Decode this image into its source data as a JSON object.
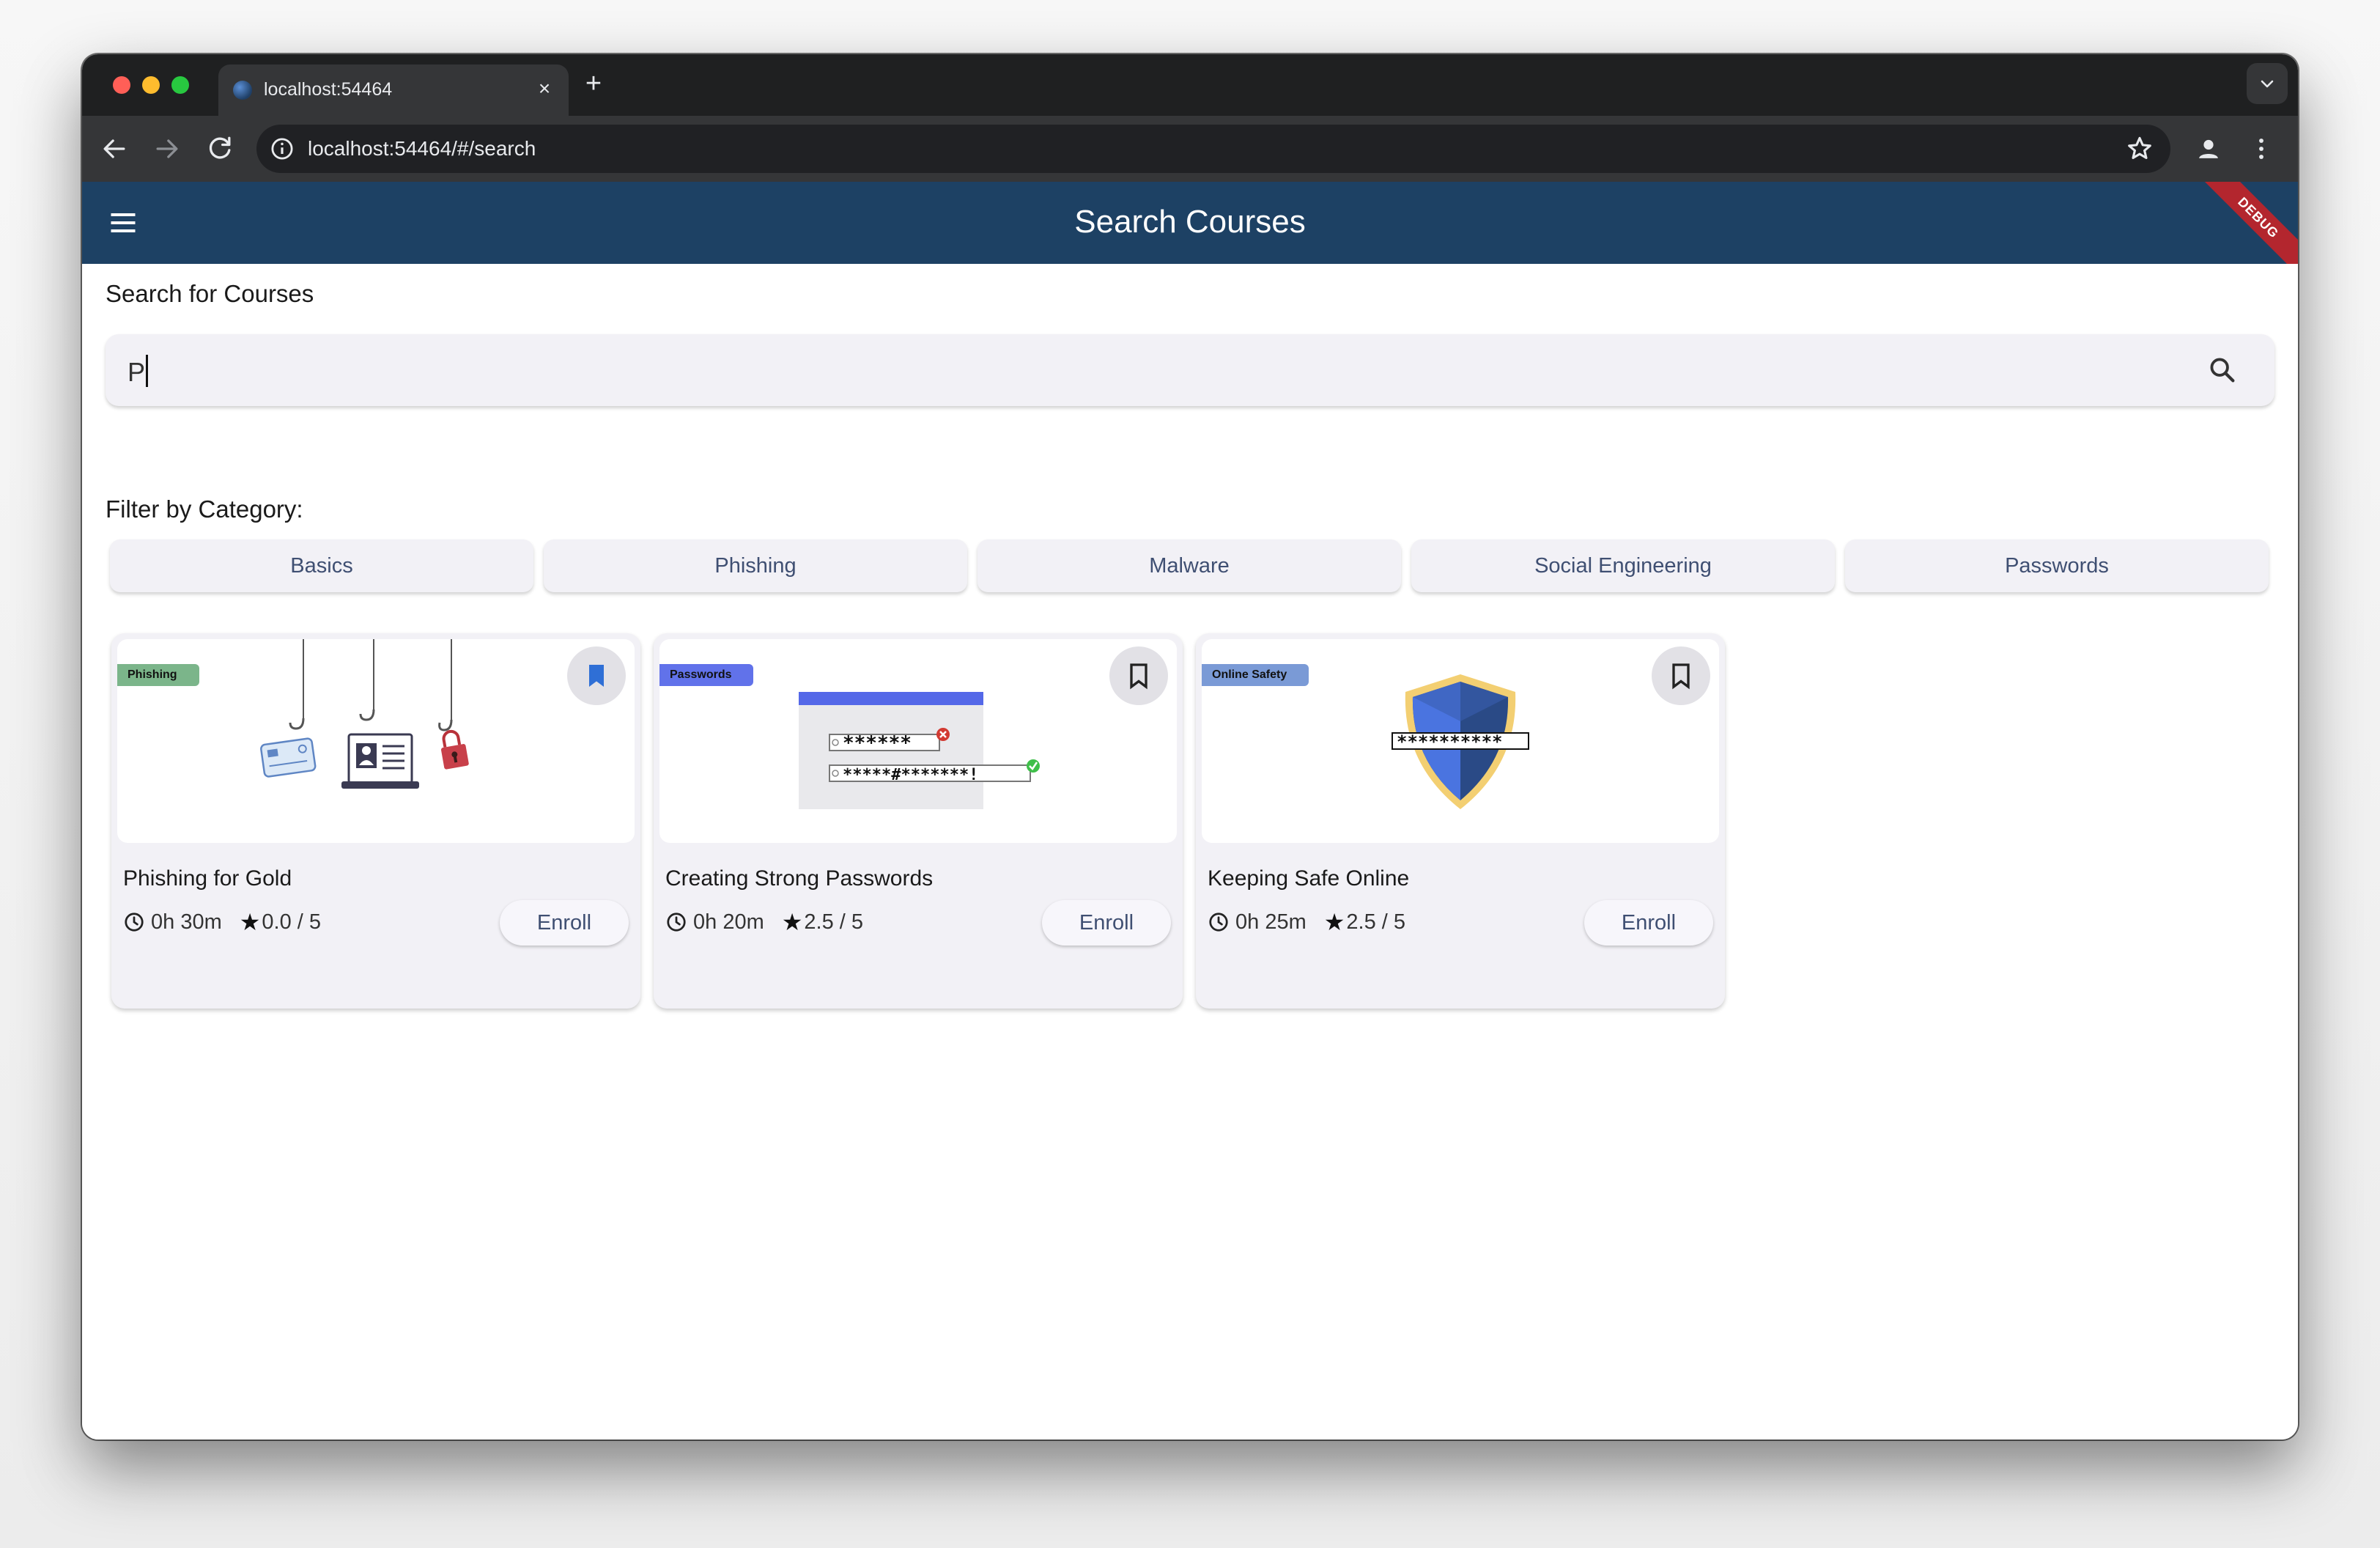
{
  "browser": {
    "tab_title": "localhost:54464",
    "tab_close_symbol": "×",
    "new_tab_symbol": "+",
    "url": "localhost:54464/#/search",
    "icons": [
      "back-arrow-icon",
      "forward-arrow-icon",
      "reload-icon",
      "site-info-icon",
      "bookmark-star-icon",
      "profile-icon",
      "kebab-menu-icon",
      "tab-dropdown-icon"
    ]
  },
  "app_bar": {
    "title": "Search Courses",
    "debug_banner": "DEBUG",
    "color": "#1d4164"
  },
  "search": {
    "heading": "Search for Courses",
    "value": "P"
  },
  "filter": {
    "heading": "Filter by Category:",
    "categories": [
      "Basics",
      "Phishing",
      "Malware",
      "Social Engineering",
      "Passwords"
    ]
  },
  "courses": [
    {
      "tag": "Phishing",
      "tag_color": "#7bb58a",
      "title": "Phishing for Gold",
      "duration": "0h 30m",
      "rating": "0.0 / 5",
      "bookmarked": true,
      "enroll_label": "Enroll",
      "password_short": "******",
      "password_long": "*****#*******!"
    },
    {
      "tag": "Passwords",
      "tag_color": "#6172ea",
      "title": "Creating Strong Passwords",
      "duration": "0h 20m",
      "rating": "2.5 / 5",
      "bookmarked": false,
      "enroll_label": "Enroll",
      "password_short": "******",
      "password_long": "*****#*******!"
    },
    {
      "tag": "Online Safety",
      "tag_color": "#7a9ad6",
      "title": "Keeping Safe Online",
      "duration": "0h 25m",
      "rating": "2.5 / 5",
      "bookmarked": false,
      "enroll_label": "Enroll",
      "password_short": "**********",
      "password_long": ""
    }
  ]
}
